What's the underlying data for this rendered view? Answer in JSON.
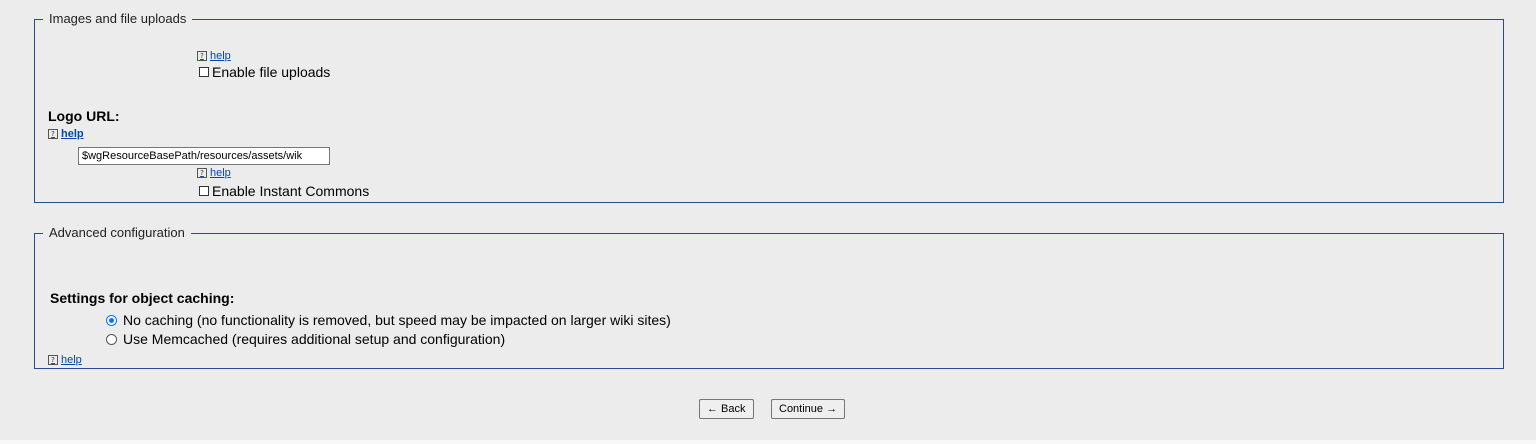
{
  "images_section": {
    "legend": "Images and file uploads",
    "help1": "help",
    "enable_uploads_label": "Enable file uploads",
    "logo_label": "Logo URL:",
    "logo_help": "help",
    "logo_value": "$wgResourceBasePath/resources/assets/wik",
    "help2": "help",
    "instant_commons_label": "Enable Instant Commons",
    "help_icon": "question-mark-icon"
  },
  "advanced_section": {
    "legend": "Advanced configuration",
    "caching_label": "Settings for object caching:",
    "options": [
      {
        "label": "No caching (no functionality is removed, but speed may be impacted on larger wiki sites)",
        "selected": true
      },
      {
        "label": "Use Memcached (requires additional setup and configuration)",
        "selected": false
      }
    ],
    "help": "help"
  },
  "nav": {
    "back_label": "← Back",
    "continue_label": "Continue →"
  },
  "colors": {
    "background": "#ececec",
    "border": "#2a4b8d",
    "link": "#0645ad",
    "radio_accent": "#0075ff"
  }
}
